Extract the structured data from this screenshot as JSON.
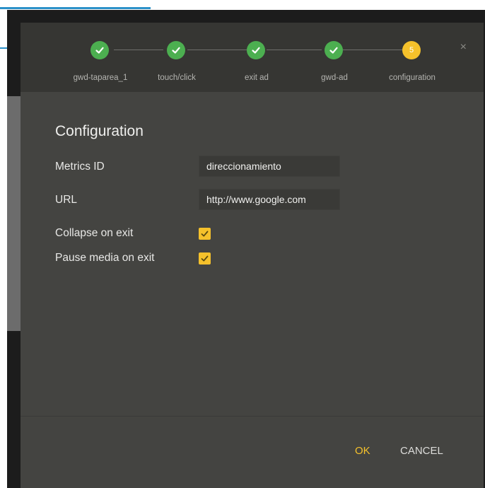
{
  "stepper": {
    "steps": [
      {
        "label": "gwd-taparea_1",
        "state": "done"
      },
      {
        "label": "touch/click",
        "state": "done"
      },
      {
        "label": "exit ad",
        "state": "done"
      },
      {
        "label": "gwd-ad",
        "state": "done"
      },
      {
        "label": "configuration",
        "state": "active",
        "number": "5"
      }
    ],
    "close_icon": "×"
  },
  "form": {
    "title": "Configuration",
    "metrics_id_label": "Metrics ID",
    "metrics_id_value": "direccionamiento",
    "url_label": "URL",
    "url_value": "http://www.google.com",
    "collapse_label": "Collapse on exit",
    "collapse_checked": true,
    "pause_label": "Pause media on exit",
    "pause_checked": true
  },
  "footer": {
    "ok_label": "OK",
    "cancel_label": "CANCEL"
  },
  "colors": {
    "accent": "#f5c12b",
    "step_done": "#4caf50",
    "dialog_bg": "#444441"
  }
}
